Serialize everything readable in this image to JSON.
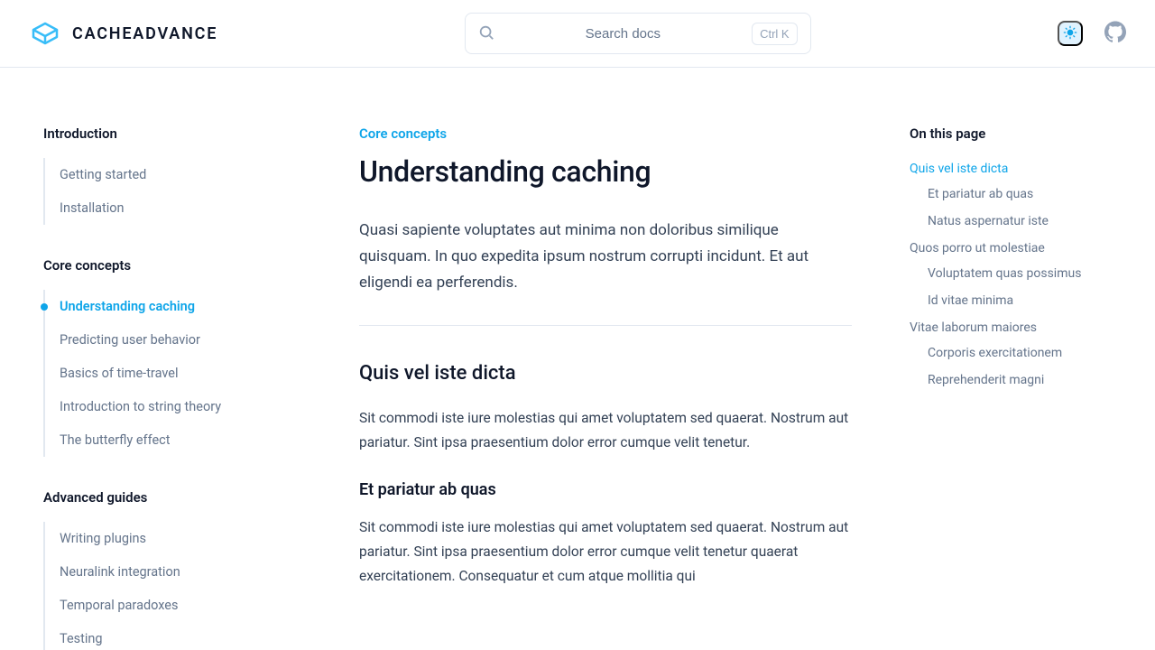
{
  "header": {
    "logo_text": "CACHEADVANCE",
    "search_placeholder": "Search docs",
    "search_shortcut": "Ctrl K"
  },
  "sidebar": {
    "sections": [
      {
        "title": "Introduction",
        "items": [
          {
            "label": "Getting started",
            "active": false
          },
          {
            "label": "Installation",
            "active": false
          }
        ]
      },
      {
        "title": "Core concepts",
        "items": [
          {
            "label": "Understanding caching",
            "active": true
          },
          {
            "label": "Predicting user behavior",
            "active": false
          },
          {
            "label": "Basics of time-travel",
            "active": false
          },
          {
            "label": "Introduction to string theory",
            "active": false
          },
          {
            "label": "The butterfly effect",
            "active": false
          }
        ]
      },
      {
        "title": "Advanced guides",
        "items": [
          {
            "label": "Writing plugins",
            "active": false
          },
          {
            "label": "Neuralink integration",
            "active": false
          },
          {
            "label": "Temporal paradoxes",
            "active": false
          },
          {
            "label": "Testing",
            "active": false
          }
        ]
      }
    ]
  },
  "article": {
    "eyebrow": "Core concepts",
    "title": "Understanding caching",
    "lead": "Quasi sapiente voluptates aut minima non doloribus similique quisquam. In quo expedita ipsum nostrum corrupti incidunt. Et aut eligendi ea perferendis.",
    "section_h2": "Quis vel iste dicta",
    "section_p1": "Sit commodi iste iure molestias qui amet voluptatem sed quaerat. Nostrum aut pariatur. Sint ipsa praesentium dolor error cumque velit tenetur.",
    "section_h3": "Et pariatur ab quas",
    "section_p2": "Sit commodi iste iure molestias qui amet voluptatem sed quaerat. Nostrum aut pariatur. Sint ipsa praesentium dolor error cumque velit tenetur quaerat exercitationem. Consequatur et cum atque mollitia qui"
  },
  "toc": {
    "title": "On this page",
    "items": [
      {
        "label": "Quis vel iste dicta",
        "active": true,
        "children": [
          {
            "label": "Et pariatur ab quas"
          },
          {
            "label": "Natus aspernatur iste"
          }
        ]
      },
      {
        "label": "Quos porro ut molestiae",
        "active": false,
        "children": [
          {
            "label": "Voluptatem quas possimus"
          },
          {
            "label": "Id vitae minima"
          }
        ]
      },
      {
        "label": "Vitae laborum maiores",
        "active": false,
        "children": [
          {
            "label": "Corporis exercitationem"
          },
          {
            "label": "Reprehenderit magni"
          }
        ]
      }
    ]
  }
}
